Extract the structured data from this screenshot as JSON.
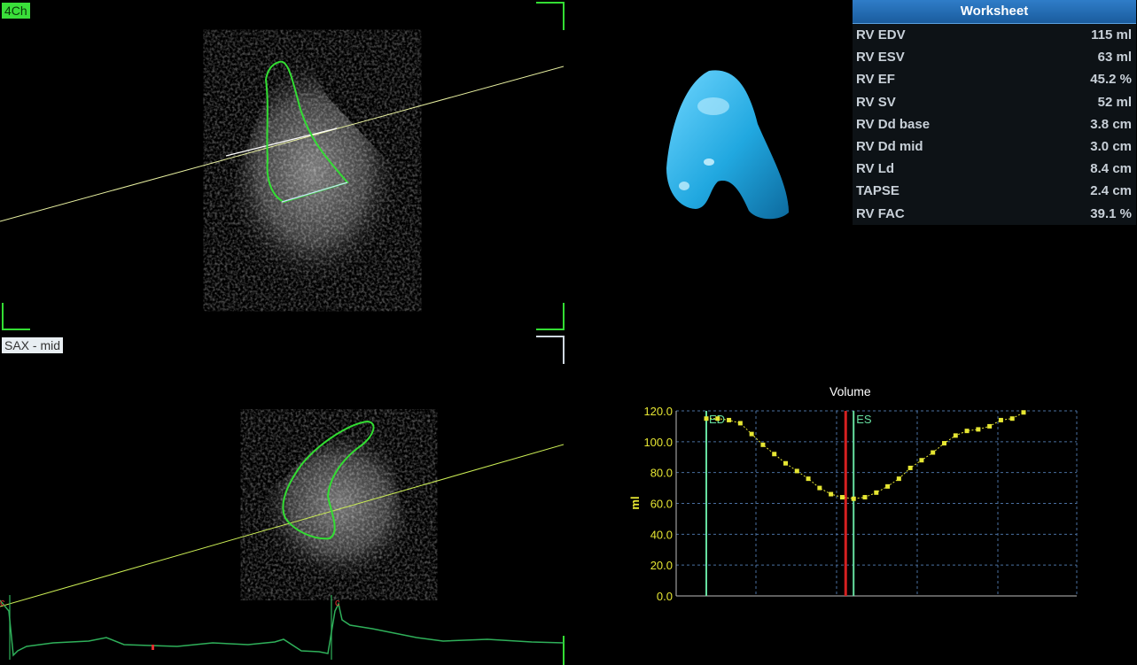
{
  "views": {
    "four_chamber_label": "4Ch",
    "sax_label": "SAX - mid"
  },
  "worksheet": {
    "title": "Worksheet",
    "rows": [
      {
        "label": "RV EDV",
        "value": "115 ml"
      },
      {
        "label": "RV ESV",
        "value": "63 ml"
      },
      {
        "label": "RV EF",
        "value": "45.2 %"
      },
      {
        "label": "RV SV",
        "value": "52 ml"
      },
      {
        "label": "RV Dd base",
        "value": "3.8 cm"
      },
      {
        "label": "RV Dd mid",
        "value": "3.0 cm"
      },
      {
        "label": "RV Ld",
        "value": "8.4 cm"
      },
      {
        "label": "TAPSE",
        "value": "2.4 cm"
      },
      {
        "label": "RV FAC",
        "value": "39.1 %"
      }
    ]
  },
  "colors": {
    "contour": "#33dd33",
    "volume_curve": "#e6e633",
    "marker_line": "#66e0a0",
    "current_frame": "#d42020",
    "rv_model": "#2ab4e6"
  },
  "chart_data": {
    "type": "line",
    "title": "Volume",
    "xlabel": "",
    "ylabel": "ml",
    "ylim": [
      0,
      120
    ],
    "yticks": [
      "0.0",
      "20.0",
      "40.0",
      "60.0",
      "80.0",
      "100.0",
      "120.0"
    ],
    "grid": true,
    "frames": [
      0,
      1,
      2,
      3,
      4,
      5,
      6,
      7,
      8,
      9,
      10,
      11,
      12,
      13,
      14,
      15,
      16,
      17,
      18,
      19,
      20,
      21,
      22,
      23,
      24,
      25,
      26,
      27,
      28
    ],
    "series": [
      {
        "values": [
          115,
          115,
          114,
          112,
          105,
          98,
          92,
          86,
          81,
          76,
          70,
          66,
          64,
          63,
          64,
          67,
          71,
          76,
          83,
          88,
          93,
          99,
          104,
          107,
          108,
          110,
          114,
          115,
          119
        ]
      }
    ],
    "markers": [
      {
        "label": "ED",
        "frame": 0
      },
      {
        "label": "ES",
        "frame": 13
      }
    ],
    "current_frame": 12.3
  }
}
